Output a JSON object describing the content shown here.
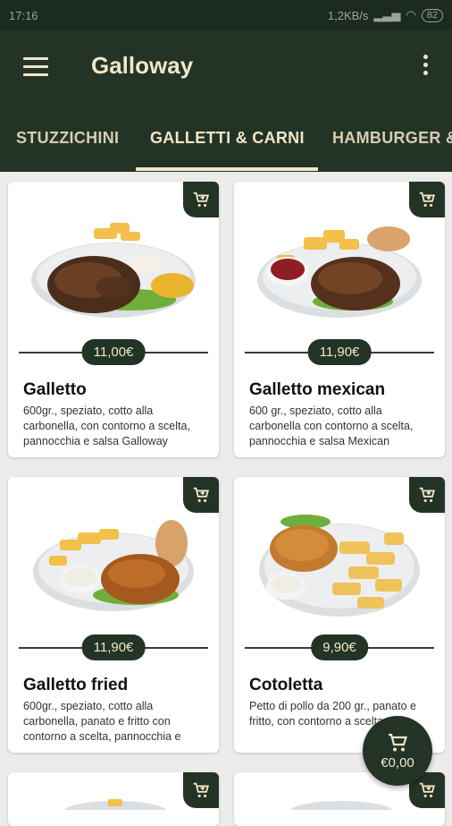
{
  "status": {
    "time": "17:16",
    "network": "1,2KB/s",
    "battery": "82"
  },
  "appbar": {
    "title": "Galloway"
  },
  "tabs": [
    {
      "label": "STUZZICHINI"
    },
    {
      "label": "GALLETTI & CARNI"
    },
    {
      "label": "HAMBURGER &"
    }
  ],
  "products": [
    {
      "name": "Galletto",
      "price": "11,00€",
      "description": "600gr., speziato, cotto alla carbonella, con contorno a scelta, pannocchia e salsa Galloway"
    },
    {
      "name": "Galletto mexican",
      "price": "11,90€",
      "description": "600 gr., speziato, cotto alla carbonella con contorno a scelta, pannocchia e salsa Mexican"
    },
    {
      "name": "Galletto fried",
      "price": "11,90€",
      "description": "600gr., speziato, cotto alla carbonella, panato e fritto con contorno a scelta, pannocchia e"
    },
    {
      "name": "Cotoletta",
      "price": "9,90€",
      "description": "Petto di pollo da 200 gr., panato e fritto, con contorno a scelta"
    }
  ],
  "cart": {
    "total": "€0,00"
  },
  "colors": {
    "primary": "#233426",
    "accent": "#f1e6c8"
  }
}
